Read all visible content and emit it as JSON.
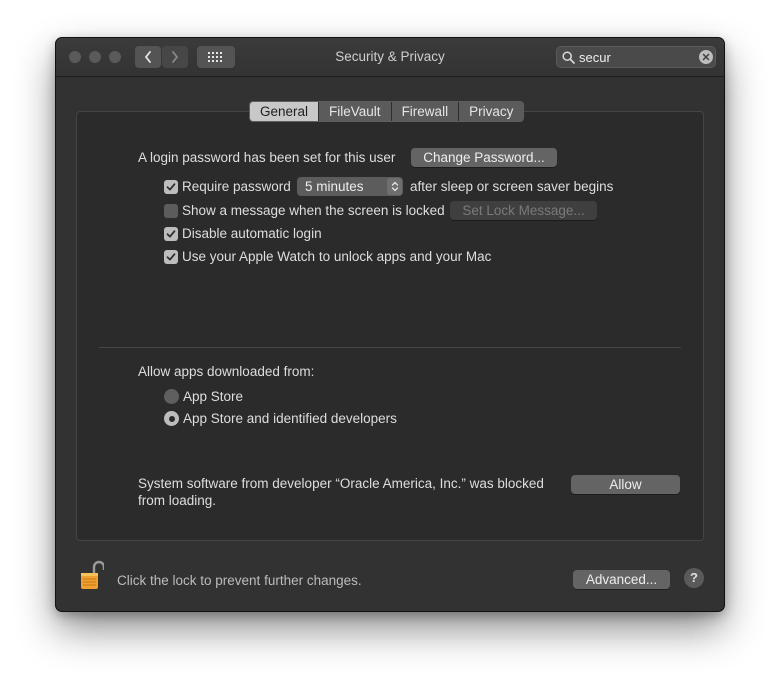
{
  "window": {
    "title": "Security & Privacy"
  },
  "search": {
    "value": "secur"
  },
  "tabs": [
    {
      "label": "General",
      "active": true
    },
    {
      "label": "FileVault",
      "active": false
    },
    {
      "label": "Firewall",
      "active": false
    },
    {
      "label": "Privacy",
      "active": false
    }
  ],
  "general": {
    "login_message": "A login password has been set for this user",
    "change_password_button": "Change Password...",
    "require_password": {
      "label": "Require password",
      "checked": true,
      "interval": "5 minutes",
      "suffix": "after sleep or screen saver begins"
    },
    "show_message": {
      "label": "Show a message when the screen is locked",
      "checked": false,
      "button": "Set Lock Message..."
    },
    "disable_auto_login": {
      "label": "Disable automatic login",
      "checked": true
    },
    "apple_watch": {
      "label": "Use your Apple Watch to unlock apps and your Mac",
      "checked": true
    }
  },
  "downloads": {
    "heading": "Allow apps downloaded from:",
    "options": [
      {
        "label": "App Store",
        "selected": false
      },
      {
        "label": "App Store and identified developers",
        "selected": true
      }
    ]
  },
  "blocked": {
    "line1": "System software from developer “Oracle America, Inc.” was blocked",
    "line2": "from loading.",
    "allow_button": "Allow"
  },
  "footer": {
    "lock_text": "Click the lock to prevent further changes.",
    "advanced_button": "Advanced...",
    "help_label": "?"
  },
  "colors": {
    "window_bg": "#323232",
    "panel_bg": "#2b2b2b",
    "lock_icon": "#f0a030"
  }
}
